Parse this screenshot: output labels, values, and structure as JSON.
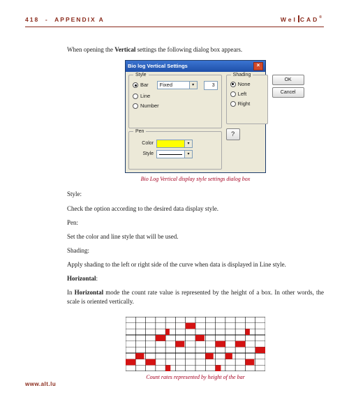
{
  "page_number": "418",
  "section_name": "APPENDIX A",
  "logo_left": "Wel",
  "logo_right": "CAD",
  "intro": "When opening the Vertical settings the following dialog box appears.",
  "intro_bold_word": "Vertical",
  "dialog": {
    "title": "Bio log Vertical Settings",
    "style_group": "Style",
    "style_bar": "Bar",
    "style_line": "Line",
    "style_number": "Number",
    "fixed": "Fixed",
    "num_value": "3",
    "pen_group": "Pen",
    "pen_color": "Color",
    "pen_style": "Style",
    "shading_group": "Shading",
    "shading_none": "None",
    "shading_left": "Left",
    "shading_right": "Right",
    "ok": "OK",
    "cancel": "Cancel"
  },
  "caption1": "Bio Log Vertical display style settings dialog box",
  "style_head": "Style:",
  "style_text": "Check the option according to the desired data display style.",
  "pen_head": "Pen:",
  "pen_text": "Set the color and line style that will be used.",
  "shade_head": "Shading:",
  "shade_text": "Apply shading to the left or right side of the curve when data is displayed in Line style.",
  "horiz_head_prefix": "Horizontal",
  "horiz_head_suffix": ":",
  "horiz_text": "In Horizontal mode the count rate value is represented by the height of a box. In other words, the scale is oriented vertically.",
  "horiz_bold_word": "Horizontal",
  "caption2": "Count rates represented by height of the bar",
  "footer_url": "www.alt.lu",
  "chart_data": {
    "type": "bar",
    "schema": "columns give bar heights, rows give bar vertical position (track). There are 14 columns and 9 tracks. Value 0 means no bar; value is barlength (0-1, ≈1.0 fills a cell width to the right of the column line).",
    "cols": 14,
    "rows": 9,
    "bars": [
      {
        "col": 0,
        "track": 7,
        "h": 1.0
      },
      {
        "col": 1,
        "track": 6,
        "h": 0.85
      },
      {
        "col": 2,
        "track": 7,
        "h": 1.0
      },
      {
        "col": 3,
        "track": 3,
        "h": 1.0
      },
      {
        "col": 4,
        "track": 2,
        "h": 0.4
      },
      {
        "col": 4,
        "track": 8,
        "h": 0.5
      },
      {
        "col": 5,
        "track": 4,
        "h": 0.9
      },
      {
        "col": 6,
        "track": 1,
        "h": 1.0
      },
      {
        "col": 7,
        "track": 3,
        "h": 0.9
      },
      {
        "col": 8,
        "track": 6,
        "h": 0.8
      },
      {
        "col": 9,
        "track": 4,
        "h": 1.0
      },
      {
        "col": 9,
        "track": 8,
        "h": 0.55
      },
      {
        "col": 10,
        "track": 6,
        "h": 0.7
      },
      {
        "col": 11,
        "track": 4,
        "h": 1.0
      },
      {
        "col": 12,
        "track": 2,
        "h": 0.45
      },
      {
        "col": 12,
        "track": 7,
        "h": 0.9
      },
      {
        "col": 13,
        "track": 5,
        "h": 1.0
      }
    ],
    "bar_color": "#d41212",
    "grid_on": true
  }
}
